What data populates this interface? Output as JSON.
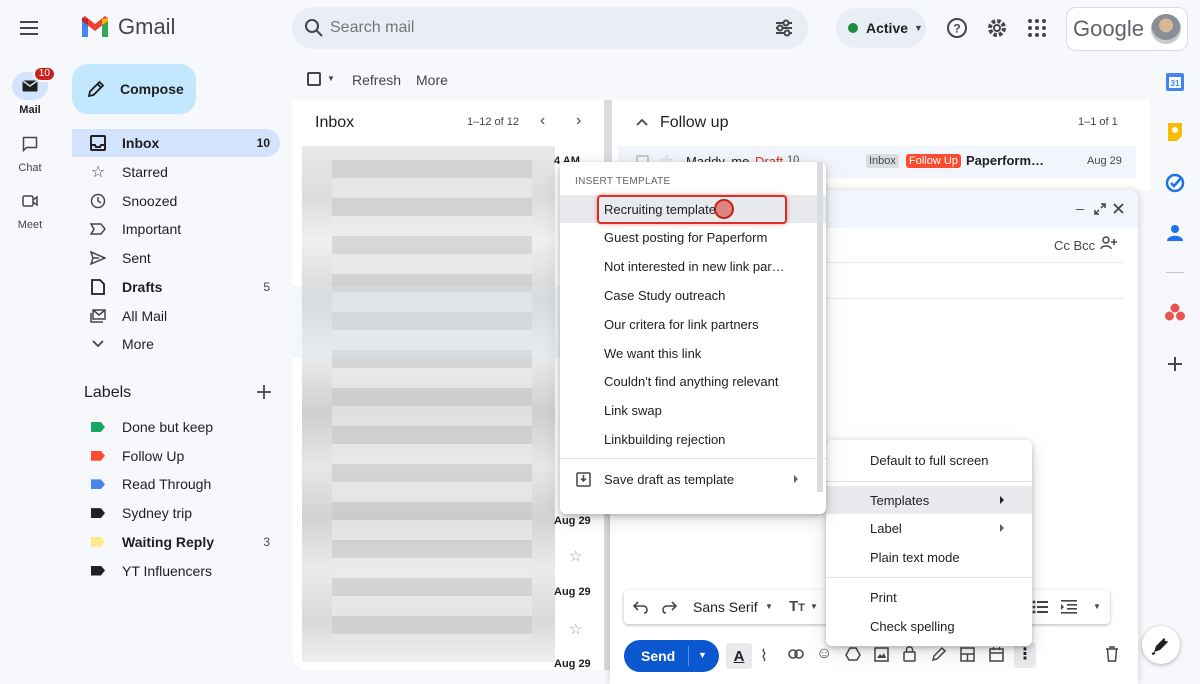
{
  "app": {
    "name": "Gmail",
    "brand_word": "Google"
  },
  "search": {
    "placeholder": "Search mail"
  },
  "status": {
    "label": "Active",
    "color": "#1e8e3e"
  },
  "rail": {
    "mail_label": "Mail",
    "mail_badge": "10",
    "chat_label": "Chat",
    "meet_label": "Meet"
  },
  "compose": {
    "label": "Compose"
  },
  "nav": {
    "inbox": {
      "label": "Inbox",
      "count": "10"
    },
    "starred": "Starred",
    "snoozed": "Snoozed",
    "important": "Important",
    "sent": "Sent",
    "drafts": {
      "label": "Drafts",
      "count": "5"
    },
    "all_mail": "All Mail",
    "more": "More"
  },
  "labels": {
    "heading": "Labels",
    "items": [
      {
        "name": "Done but keep",
        "color": "#16a765",
        "count": ""
      },
      {
        "name": "Follow Up",
        "color": "#fb4c2f",
        "count": ""
      },
      {
        "name": "Read Through",
        "color": "#4a86e8",
        "count": ""
      },
      {
        "name": "Sydney trip",
        "color": "#202124",
        "count": ""
      },
      {
        "name": "Waiting Reply",
        "color": "#fde88a",
        "count": "3"
      },
      {
        "name": "YT Influencers",
        "color": "#202124",
        "count": ""
      }
    ]
  },
  "toolbar": {
    "refresh": "Refresh",
    "more": "More"
  },
  "inbox_section": {
    "title": "Inbox",
    "range": "1–12 of 12",
    "dates": [
      "4 AM",
      "Aug 29",
      "Aug 29",
      "Aug 29"
    ]
  },
  "followup": {
    "title": "Follow up",
    "range": "1–1 of 1",
    "row": {
      "sender": "Maddy, me",
      "draft": "Draft",
      "count": "10",
      "label_inbox": "Inbox",
      "label_follow": "Follow Up",
      "subject": "Paperform…",
      "date": "Aug 29"
    }
  },
  "compose_window": {
    "cc_bcc": "Cc Bcc",
    "font": "Sans Serif",
    "send": "Send"
  },
  "template_menu": {
    "heading": "INSERT TEMPLATE",
    "items": [
      "Recruiting template",
      "Guest posting for Paperform",
      "Not interested in new link par…",
      "Case Study outreach",
      "Our critera for link partners",
      "We want this link",
      "Couldn't find anything relevant",
      "Link swap",
      "Linkbuilding rejection"
    ],
    "save_draft": "Save draft as template"
  },
  "options_menu": {
    "full_screen": "Default to full screen",
    "templates": "Templates",
    "label": "Label",
    "plain_text": "Plain text mode",
    "print": "Print",
    "check_spelling": "Check spelling"
  }
}
